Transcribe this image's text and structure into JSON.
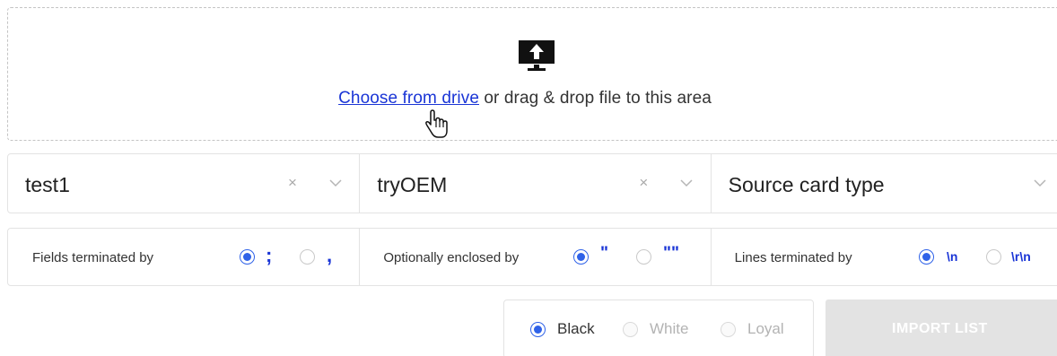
{
  "dropzone": {
    "link_text": "Choose from drive",
    "rest_text": " or drag & drop file to this area",
    "icon": "upload-monitor-icon"
  },
  "selects": [
    {
      "value": "test1",
      "clearable": true
    },
    {
      "value": "tryOEM",
      "clearable": true
    },
    {
      "value": "Source card type",
      "clearable": false
    }
  ],
  "options": {
    "fields": {
      "label": "Fields terminated by",
      "choices": [
        ";",
        ","
      ],
      "selected": ";"
    },
    "enclosed": {
      "label": "Optionally enclosed by",
      "choices": [
        "\"",
        "\"\""
      ],
      "selected": "\""
    },
    "lines": {
      "label": "Lines terminated by",
      "choices": [
        "\\n",
        "\\r\\n"
      ],
      "selected": "\\n"
    }
  },
  "theme": {
    "choices": [
      "Black",
      "White",
      "Loyal"
    ],
    "selected": "Black"
  },
  "import_button": {
    "label": "IMPORT LIST",
    "disabled": true
  },
  "colors": {
    "accent": "#2f62e8",
    "link": "#1a35d6",
    "border": "#e3e3e3",
    "disabled_button": "#e3e3e3"
  },
  "icons": {
    "clear": "×",
    "chevron": "chevron-down-icon",
    "cursor": "hand-pointer-icon"
  }
}
